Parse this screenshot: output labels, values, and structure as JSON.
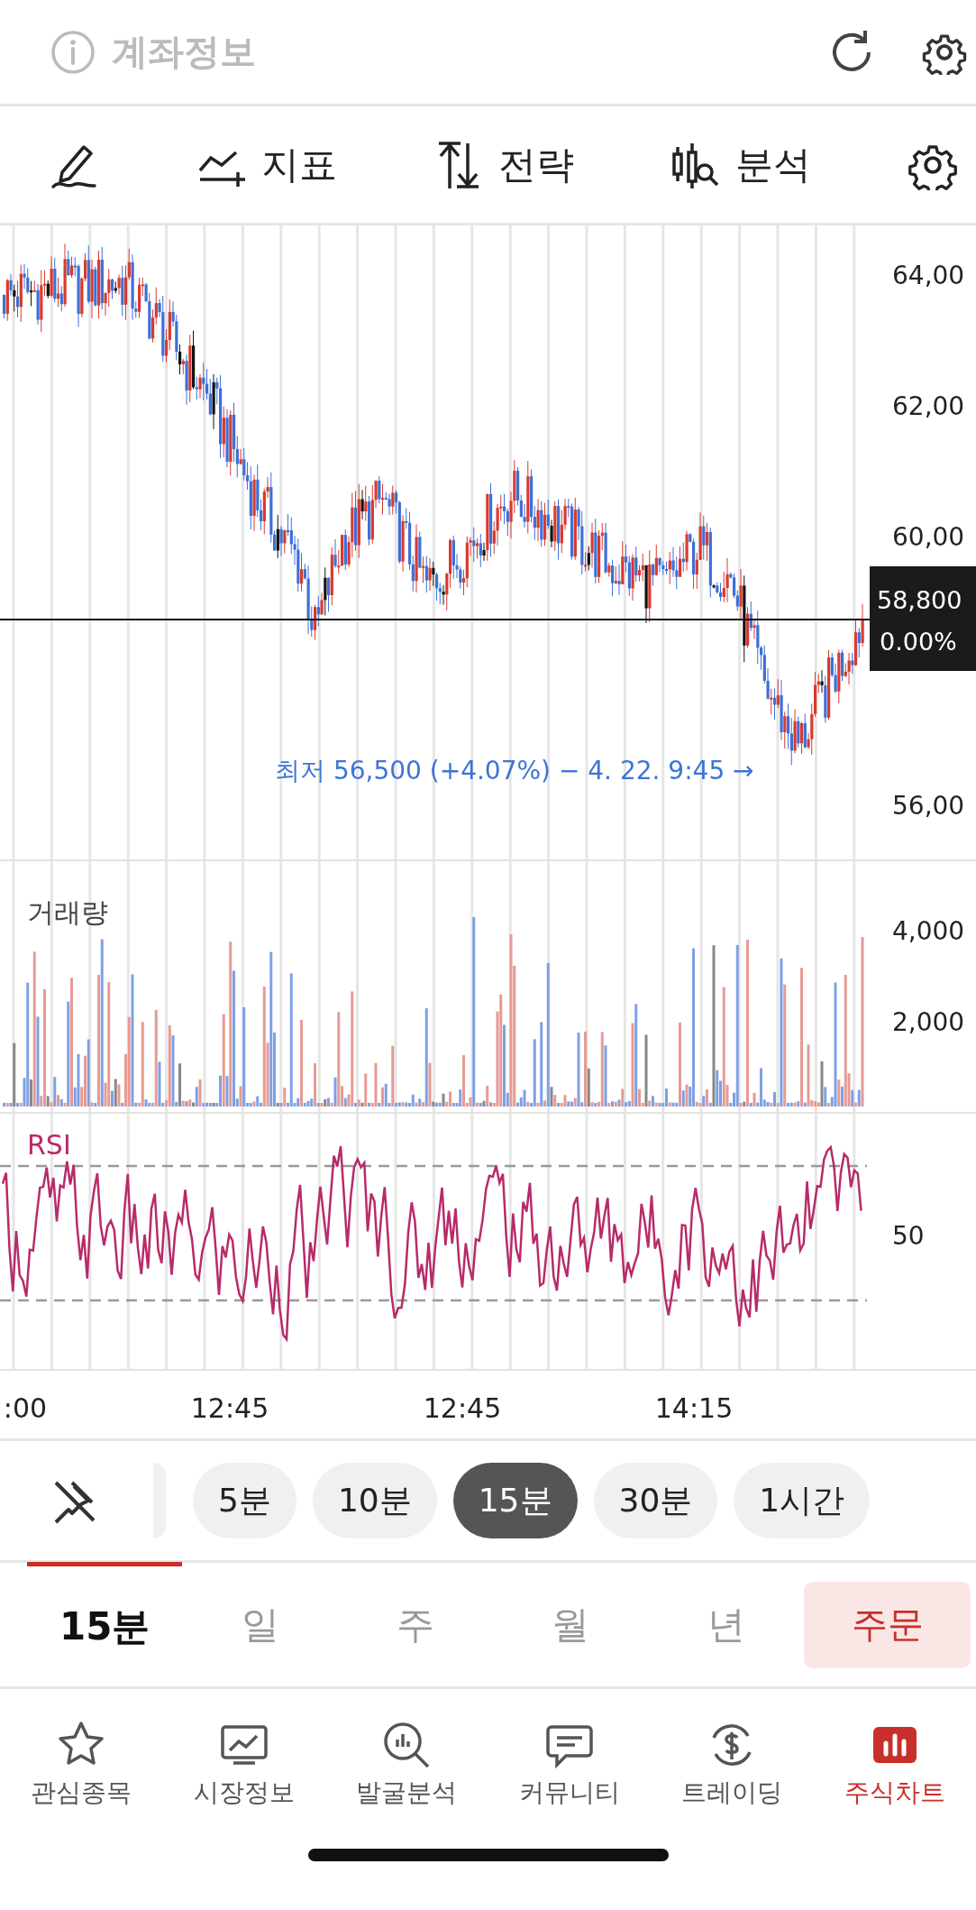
{
  "header": {
    "title": "계좌정보"
  },
  "toolbar": {
    "tools": [
      {
        "label": "지표"
      },
      {
        "label": "전략"
      },
      {
        "label": "분석"
      }
    ]
  },
  "price_chart": {
    "axis_labels": [
      "64,00",
      "62,00",
      "60,00",
      "56,00"
    ],
    "current_price": {
      "value": "58,800",
      "change": "0.00%"
    },
    "low_note": "최저 56,500 (+4.07%) − 4. 22. 9:45 →"
  },
  "volume_chart": {
    "title": "거래량",
    "axis_labels": [
      "4,000",
      "2,000"
    ]
  },
  "rsi_chart": {
    "title": "RSI",
    "axis_labels": [
      "50"
    ]
  },
  "time_axis": {
    "labels": [
      ":00",
      "12:45",
      "12:45",
      "14:15"
    ]
  },
  "intervals": [
    {
      "label": "5분",
      "selected": false
    },
    {
      "label": "10분",
      "selected": false
    },
    {
      "label": "15분",
      "selected": true
    },
    {
      "label": "30분",
      "selected": false
    },
    {
      "label": "1시간",
      "selected": false
    }
  ],
  "periods": [
    {
      "label": "15분",
      "selected": true
    },
    {
      "label": "일",
      "selected": false
    },
    {
      "label": "주",
      "selected": false
    },
    {
      "label": "월",
      "selected": false
    },
    {
      "label": "년",
      "selected": false
    }
  ],
  "order_button": {
    "label": "주문"
  },
  "nav": [
    {
      "label": "관심종목",
      "selected": false
    },
    {
      "label": "시장정보",
      "selected": false
    },
    {
      "label": "발굴분석",
      "selected": false
    },
    {
      "label": "커뮤니티",
      "selected": false
    },
    {
      "label": "트레이딩",
      "selected": false
    },
    {
      "label": "주식차트",
      "selected": true
    }
  ]
}
